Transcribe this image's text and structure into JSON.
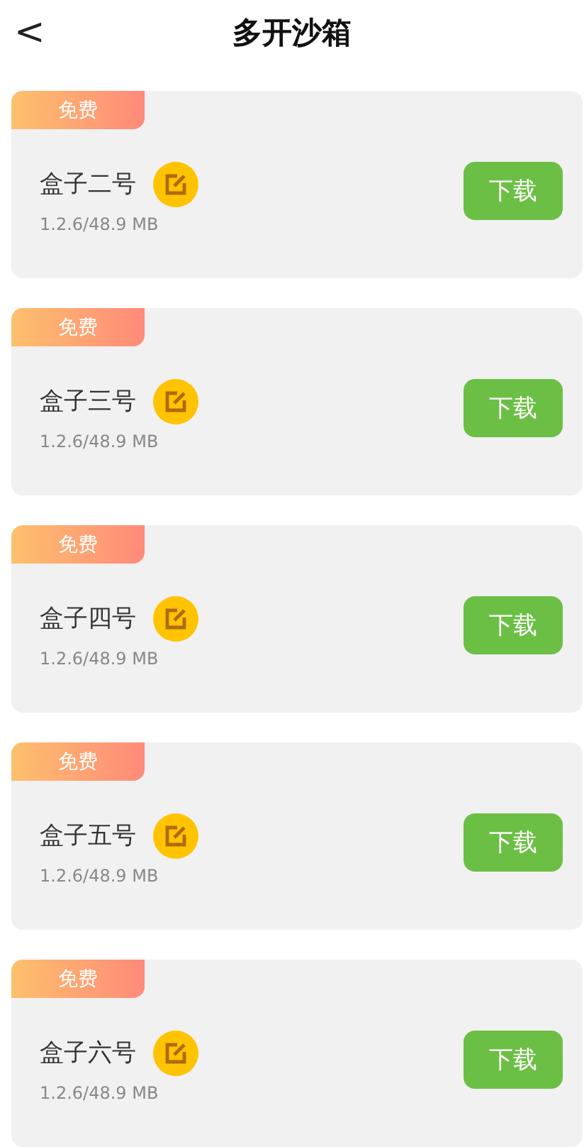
{
  "header": {
    "back": "<",
    "title": "多开沙箱"
  },
  "items": [
    {
      "badge": "免费",
      "name": "盒子二号",
      "version": "1.2.6/48.9 MB",
      "button": "下载"
    },
    {
      "badge": "免费",
      "name": "盒子三号",
      "version": "1.2.6/48.9 MB",
      "button": "下载"
    },
    {
      "badge": "免费",
      "name": "盒子四号",
      "version": "1.2.6/48.9 MB",
      "button": "下载"
    },
    {
      "badge": "免费",
      "name": "盒子五号",
      "version": "1.2.6/48.9 MB",
      "button": "下载"
    },
    {
      "badge": "免费",
      "name": "盒子六号",
      "version": "1.2.6/48.9 MB",
      "button": "下载"
    }
  ]
}
